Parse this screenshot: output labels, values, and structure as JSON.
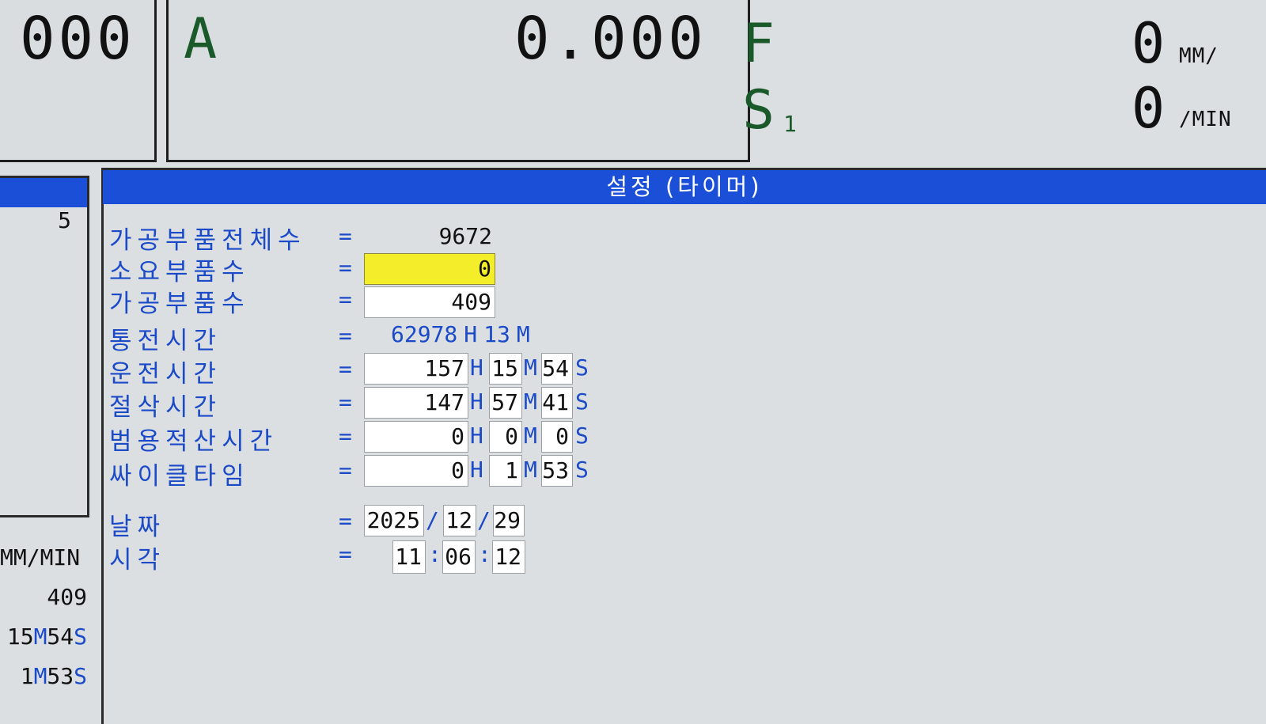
{
  "top": {
    "left_digits": "000",
    "axis": {
      "letter": "A",
      "value": "0.000"
    },
    "feed": {
      "letter": "F",
      "value": "0",
      "unit": "MM/"
    },
    "spindle": {
      "letter": "S",
      "sub": "1",
      "value": "0",
      "unit": "/MIN"
    }
  },
  "side": {
    "top_value": "5",
    "unit_label": "MM/MIN",
    "parts_value": "409",
    "run_time": {
      "m": "15",
      "m_unit": "M",
      "s": "54",
      "s_unit": "S"
    },
    "cycle_time": {
      "m": "1",
      "m_unit": "M",
      "s": "53",
      "s_unit": "S"
    }
  },
  "screen": {
    "title": "설정 (타이머)",
    "eq": "=",
    "rows": {
      "total_parts": {
        "label": "가공부품전체수",
        "value": "9672"
      },
      "required_parts": {
        "label": "소요부품수",
        "value": "0"
      },
      "machined_parts": {
        "label": "가공부품수",
        "value": "409"
      },
      "power_on_time": {
        "label": "통전시간",
        "hours": "62978",
        "h_unit": "H",
        "minutes": "13",
        "m_unit": "M"
      },
      "operation_time": {
        "label": "운전시간",
        "hours": "157",
        "minutes": "15",
        "seconds": "54",
        "h_unit": "H",
        "m_unit": "M",
        "s_unit": "S"
      },
      "cutting_time": {
        "label": "절삭시간",
        "hours": "147",
        "minutes": "57",
        "seconds": "41",
        "h_unit": "H",
        "m_unit": "M",
        "s_unit": "S"
      },
      "general_time": {
        "label": "범용적산시간",
        "hours": "0",
        "minutes": "0",
        "seconds": "0",
        "h_unit": "H",
        "m_unit": "M",
        "s_unit": "S"
      },
      "cycle_time": {
        "label": "싸이클타임",
        "hours": "0",
        "minutes": "1",
        "seconds": "53",
        "h_unit": "H",
        "m_unit": "M",
        "s_unit": "S"
      },
      "date": {
        "label": "날짜",
        "year": "2025",
        "month": "12",
        "day": "29",
        "sep": "/"
      },
      "time": {
        "label": "시각",
        "hour": "11",
        "minute": "06",
        "second": "12",
        "sep": ":"
      }
    }
  }
}
